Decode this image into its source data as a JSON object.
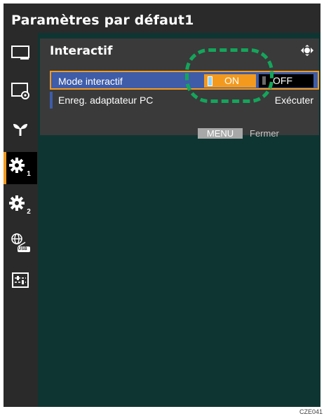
{
  "window": {
    "title": "Paramètres par défaut1"
  },
  "sidebar": {
    "items": [
      {
        "icon": "monitor-icon"
      },
      {
        "icon": "monitor-gear-icon"
      },
      {
        "icon": "eco-plant-icon"
      },
      {
        "icon": "gear-icon",
        "label": "1",
        "active": true
      },
      {
        "icon": "gear-icon",
        "label": "2"
      },
      {
        "icon": "network-usb-icon",
        "label": "USB"
      },
      {
        "icon": "settings-panel-icon"
      }
    ]
  },
  "panel": {
    "title": "Interactif",
    "rows": [
      {
        "label": "Mode interactif",
        "options": [
          "ON",
          "OFF"
        ],
        "selected": "ON"
      },
      {
        "label": "Enreg. adaptateur PC",
        "action": "Exécuter"
      }
    ],
    "footer": {
      "menu_label": "MENU",
      "close_label": "Fermer"
    }
  },
  "caption": "CZE041",
  "colors": {
    "accent": "#f39a1e",
    "selection": "#3e5ca8",
    "highlight": "#13a65b",
    "content_bg": "#0f3532"
  }
}
